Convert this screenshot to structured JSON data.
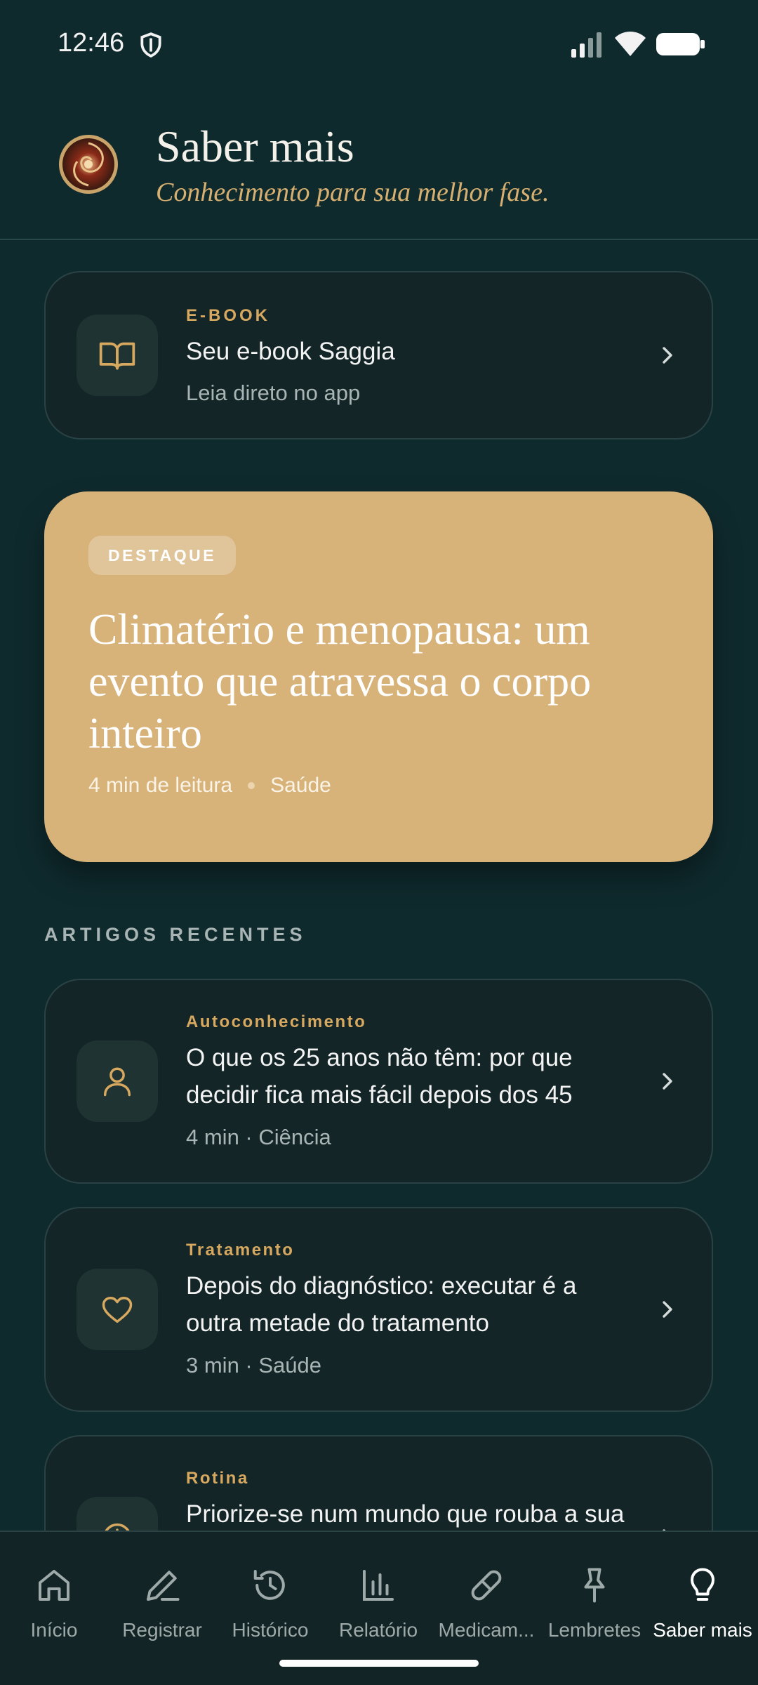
{
  "status_bar": {
    "time": "12:46"
  },
  "header": {
    "title": "Saber mais",
    "subtitle": "Conhecimento para sua melhor fase."
  },
  "ebook_card": {
    "kicker": "E-BOOK",
    "title": "Seu e-book Saggia",
    "meta": "Leia direto no app",
    "icon": "book-open-icon"
  },
  "featured": {
    "badge": "DESTAQUE",
    "title": "Climatério e menopausa: um evento que atravessa o corpo inteiro",
    "read_time": "4 min de leitura",
    "category": "Saúde",
    "background_color": "#d7b279"
  },
  "recent": {
    "label": "ARTIGOS RECENTES",
    "articles": [
      {
        "category": "Autoconhecimento",
        "title": "O que os 25 anos não têm: por que decidir fica mais fácil depois dos 45",
        "meta": "4 min · Ciência",
        "icon": "person-icon"
      },
      {
        "category": "Tratamento",
        "title": "Depois do diagnóstico: executar é a outra metade do tratamento",
        "meta": "3 min · Saúde",
        "icon": "heart-icon"
      },
      {
        "category": "Rotina",
        "title": "Priorize-se num mundo que rouba a sua",
        "meta": "",
        "icon": "clock-icon"
      }
    ]
  },
  "nav": {
    "items": [
      {
        "label": "Início",
        "icon": "home-icon"
      },
      {
        "label": "Registrar",
        "icon": "pencil-icon"
      },
      {
        "label": "Histórico",
        "icon": "history-icon"
      },
      {
        "label": "Relatório",
        "icon": "bar-chart-icon"
      },
      {
        "label": "Medicam...",
        "icon": "pill-icon"
      },
      {
        "label": "Lembretes",
        "icon": "pin-icon"
      },
      {
        "label": "Saber mais",
        "icon": "lightbulb-icon"
      }
    ],
    "active": "Saber mais"
  },
  "colors": {
    "background": "#0f2a2d",
    "accent": "#d7a85f",
    "card": "#132527"
  }
}
